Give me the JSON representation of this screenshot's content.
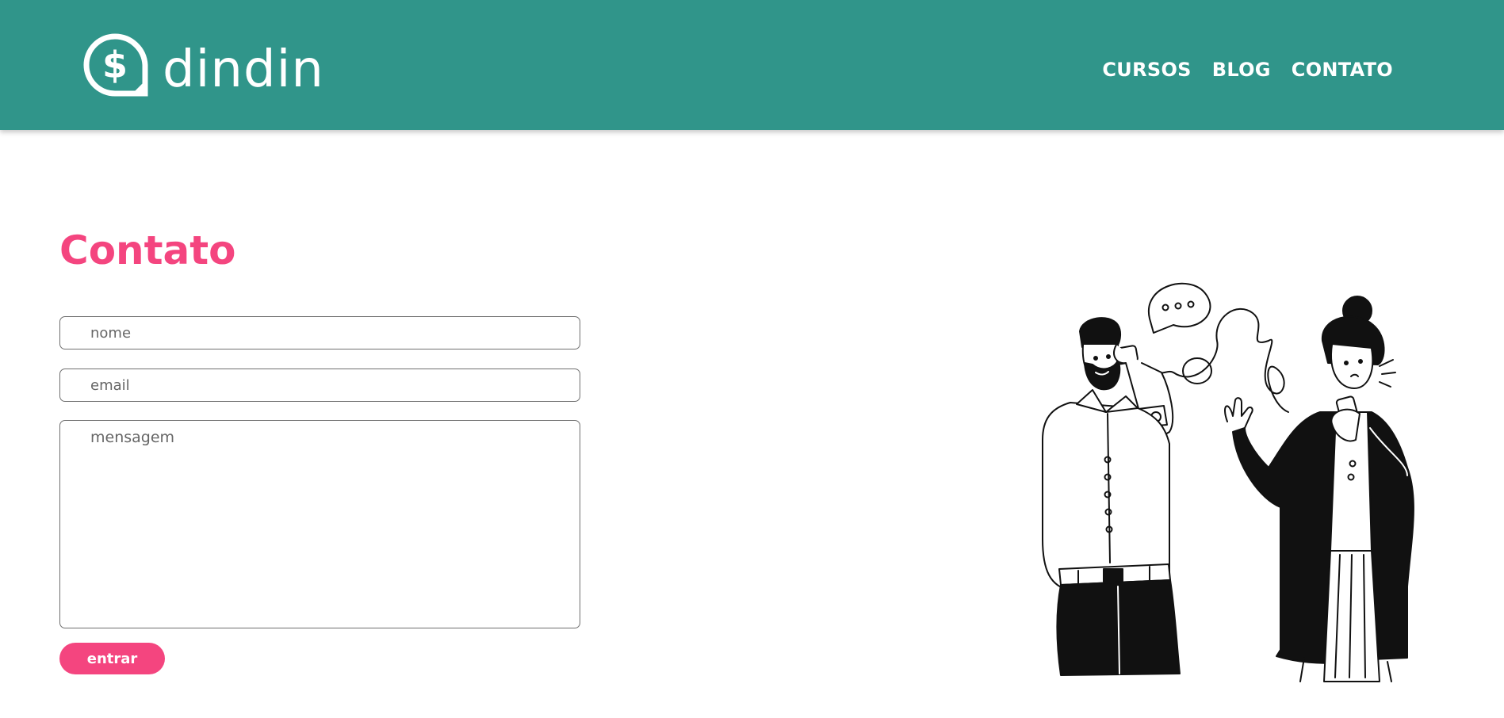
{
  "header": {
    "brand": "dindin",
    "logo_icon": "dollar-speech-bubble-icon",
    "nav": [
      "CURSOS",
      "BLOG",
      "CONTATO"
    ],
    "background": "#30958a"
  },
  "main": {
    "title": "Contato",
    "form": {
      "name_placeholder": "nome",
      "email_placeholder": "email",
      "message_placeholder": "mensagem",
      "submit_label": "entrar"
    },
    "illustration": "two-people-talking-tin-can-phone"
  },
  "colors": {
    "accent": "#f4457f",
    "header": "#30958a"
  }
}
